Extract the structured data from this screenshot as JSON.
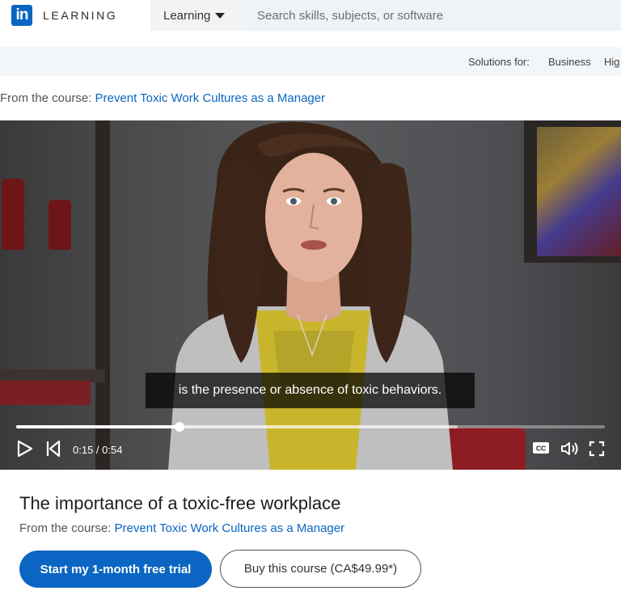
{
  "header": {
    "logo_mark": "in",
    "logo_text": "LEARNING",
    "nav_dropdown_label": "Learning",
    "search_placeholder": "Search skills, subjects, or software"
  },
  "solutions_bar": {
    "label": "Solutions for:",
    "links": [
      "Business",
      "Hig"
    ]
  },
  "course_line_top": {
    "prefix": "From the course: ",
    "course_title": "Prevent Toxic Work Cultures as a Manager"
  },
  "video": {
    "caption": "is the presence or absence of toxic behaviors.",
    "current_time": "0:15",
    "duration": "0:54",
    "time_display": "0:15 / 0:54",
    "progress_fraction": 0.278,
    "buffer_fraction": 0.75,
    "controls": [
      "play-icon",
      "skip-back-icon",
      "closed-captions-icon",
      "volume-icon",
      "fullscreen-icon"
    ],
    "cc_label": "CC"
  },
  "content": {
    "title": "The importance of a toxic-free workplace",
    "course_prefix": "From the course: ",
    "course_title": "Prevent Toxic Work Cultures as a Manager",
    "primary_button": "Start my 1-month free trial",
    "secondary_button": "Buy this course (CA$49.99*)"
  },
  "colors": {
    "brand": "#0a66c2",
    "search_bg": "#eef3f8"
  }
}
